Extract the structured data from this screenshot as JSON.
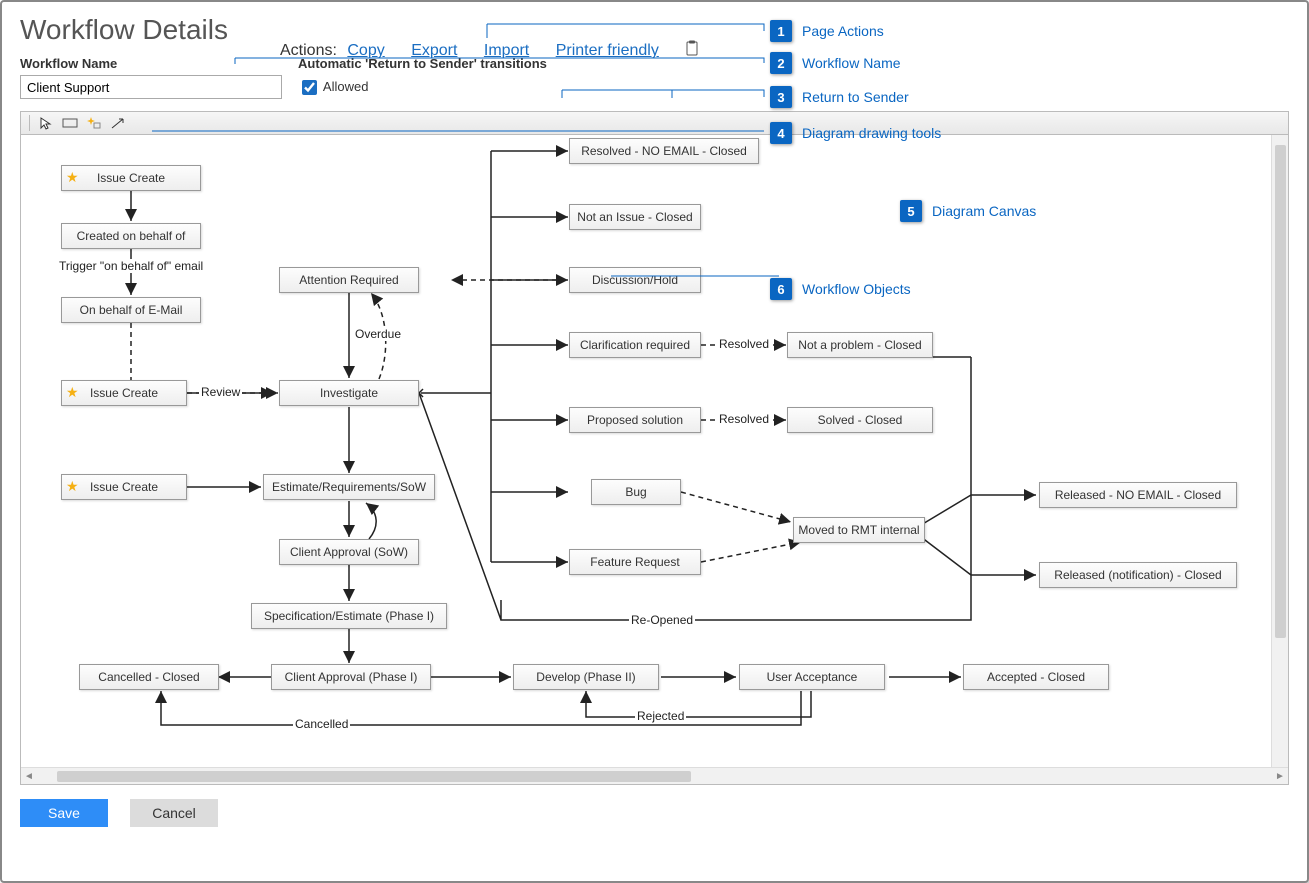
{
  "page_title": "Workflow Details",
  "actions": {
    "label": "Actions:",
    "copy": "Copy",
    "export": "Export",
    "import": "Import",
    "printer": "Printer friendly"
  },
  "workflow_name_label": "Workflow Name",
  "workflow_name_value": "Client Support",
  "rts_label": "Automatic 'Return to Sender' transitions",
  "rts_allowed_label": "Allowed",
  "toolbar": {
    "select": "select-tool",
    "rect": "state-box-tool",
    "new": "sparkle-new-tool",
    "arrow": "transition-arrow-tool"
  },
  "callouts": [
    {
      "n": "1",
      "label": "Page Actions"
    },
    {
      "n": "2",
      "label": "Workflow Name"
    },
    {
      "n": "3",
      "label": "Return to Sender"
    },
    {
      "n": "4",
      "label": "Diagram drawing tools"
    },
    {
      "n": "5",
      "label": "Diagram Canvas"
    },
    {
      "n": "6",
      "label": "Workflow Objects"
    }
  ],
  "nodes": {
    "issue_create_1": "Issue Create",
    "created_on_behalf": "Created on behalf of",
    "on_behalf_email": "On behalf of E-Mail",
    "issue_create_2": "Issue Create",
    "issue_create_3": "Issue Create",
    "attention_required": "Attention Required",
    "investigate": "Investigate",
    "estimate_req": "Estimate/Requirements/SoW",
    "client_approval_sow": "Client Approval (SoW)",
    "spec_estimate": "Specification/Estimate (Phase I)",
    "cancelled_closed": "Cancelled - Closed",
    "client_approval_p1": "Client Approval (Phase I)",
    "develop_p2": "Develop (Phase II)",
    "user_acceptance": "User Acceptance",
    "accepted_closed": "Accepted - Closed",
    "resolved_noemail": "Resolved - NO EMAIL - Closed",
    "not_issue_closed": "Not an Issue - Closed",
    "discussion_hold": "Discussion/Hold",
    "clarification": "Clarification required",
    "not_problem_closed": "Not a problem - Closed",
    "proposed_solution": "Proposed solution",
    "solved_closed": "Solved - Closed",
    "bug": "Bug",
    "moved_rmt": "Moved to RMT internal",
    "feature_request": "Feature Request",
    "released_noemail": "Released - NO EMAIL - Closed",
    "released_notif": "Released (notification) - Closed"
  },
  "edge_labels": {
    "trigger_email": "Trigger \"on behalf of\" email",
    "overdue": "Overdue",
    "review": "Review",
    "resolved1": "Resolved",
    "resolved2": "Resolved",
    "reopened": "Re-Opened",
    "cancelled": "Cancelled",
    "rejected": "Rejected"
  },
  "buttons": {
    "save": "Save",
    "cancel": "Cancel"
  }
}
